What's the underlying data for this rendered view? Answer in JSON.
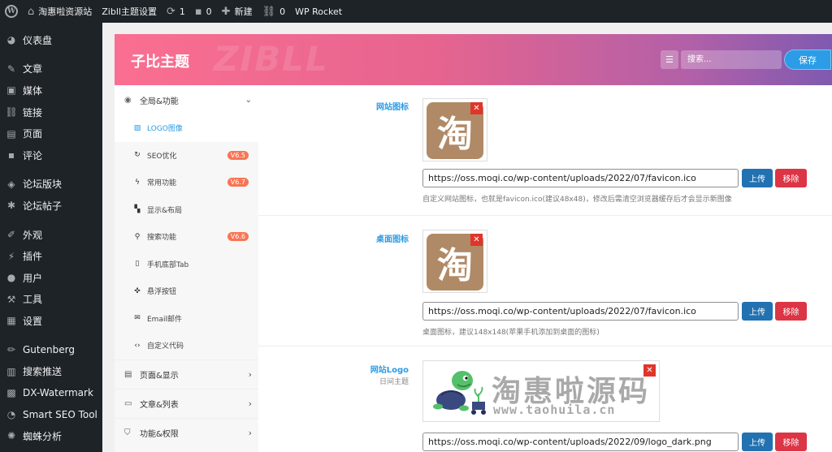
{
  "adminbar": {
    "items": [
      {
        "label": "淘惠啦资源站",
        "icon": "home-icon"
      },
      {
        "label": "Zibll主题设置"
      },
      {
        "label": "1",
        "icon": "update-icon"
      },
      {
        "label": "0",
        "icon": "comment-icon"
      },
      {
        "label": "新建",
        "icon": "plus-icon"
      },
      {
        "label": "0",
        "icon": "link-icon"
      },
      {
        "label": "WP Rocket"
      }
    ]
  },
  "sidebar": {
    "items": [
      {
        "label": "仪表盘",
        "icon": "dashboard-icon"
      },
      {
        "label": "文章",
        "icon": "pin-icon"
      },
      {
        "label": "媒体",
        "icon": "media-icon"
      },
      {
        "label": "链接",
        "icon": "link-icon"
      },
      {
        "label": "页面",
        "icon": "page-icon"
      },
      {
        "label": "评论",
        "icon": "comment-icon"
      },
      {
        "label": "论坛版块",
        "icon": "layers-icon"
      },
      {
        "label": "论坛帖子",
        "icon": "gear-icon"
      },
      {
        "label": "外观",
        "icon": "brush-icon"
      },
      {
        "label": "插件",
        "icon": "plugin-icon"
      },
      {
        "label": "用户",
        "icon": "user-icon"
      },
      {
        "label": "工具",
        "icon": "wrench-icon"
      },
      {
        "label": "设置",
        "icon": "settings-icon"
      },
      {
        "label": "Gutenberg",
        "icon": "pencil-icon"
      },
      {
        "label": "搜索推送",
        "icon": "calendar-icon"
      },
      {
        "label": "DX-Watermark",
        "icon": "image-icon"
      },
      {
        "label": "Smart SEO Tool",
        "icon": "seo-icon"
      },
      {
        "label": "蜘蛛分析",
        "icon": "spider-icon"
      }
    ]
  },
  "header": {
    "brand": "子比主题",
    "watermark": "ZIBLL",
    "search_placeholder": "搜索...",
    "save_label": "保存"
  },
  "nav": {
    "group_open": {
      "label": "全局&功能",
      "icon": "target-icon"
    },
    "subs": [
      {
        "label": "LOGO图像",
        "icon": "image-icon"
      },
      {
        "label": "SEO优化",
        "icon": "refresh-icon",
        "badge": "V6.5"
      },
      {
        "label": "常用功能",
        "icon": "bolt-icon",
        "badge": "V6.7"
      },
      {
        "label": "显示&布局",
        "icon": "layout-icon"
      },
      {
        "label": "搜索功能",
        "icon": "search-icon",
        "badge": "V6.6"
      },
      {
        "label": "手机底部Tab",
        "icon": "mobile-icon"
      },
      {
        "label": "悬浮按钮",
        "icon": "pin-icon"
      },
      {
        "label": "Email邮件",
        "icon": "mail-icon"
      },
      {
        "label": "自定义代码",
        "icon": "code-icon"
      }
    ],
    "groups": [
      {
        "label": "页面&显示",
        "icon": "calendar-icon"
      },
      {
        "label": "文章&列表",
        "icon": "book-icon"
      },
      {
        "label": "功能&权限",
        "icon": "shield-icon"
      }
    ]
  },
  "fields": [
    {
      "label": "网站图标",
      "image_char": "淘",
      "url": "https://oss.moqi.co/wp-content/uploads/2022/07/favicon.ico",
      "desc": "自定义网站图标，也就是favicon.ico(建议48x48)，修改后需清空浏览器缓存后才会显示新图像",
      "upload_label": "上传",
      "remove_label": "移除"
    },
    {
      "label": "桌面图标",
      "image_char": "淘",
      "url": "https://oss.moqi.co/wp-content/uploads/2022/07/favicon.ico",
      "desc": "桌面图标，建议148x148(苹果手机添加到桌面的图标)",
      "upload_label": "上传",
      "remove_label": "移除"
    },
    {
      "label": "网站Logo",
      "sublabel": "日间主题",
      "logo_cn": "淘惠啦源码",
      "logo_en": "www.taohuila.cn",
      "url": "https://oss.moqi.co/wp-content/uploads/2022/09/logo_dark.png",
      "upload_label": "上传",
      "remove_label": "移除"
    }
  ],
  "colors": {
    "accent": "#2c9ce6",
    "danger": "#dc3545",
    "upload": "#2271b1",
    "badge": "#f87554",
    "admin_dark": "#1d2327"
  }
}
